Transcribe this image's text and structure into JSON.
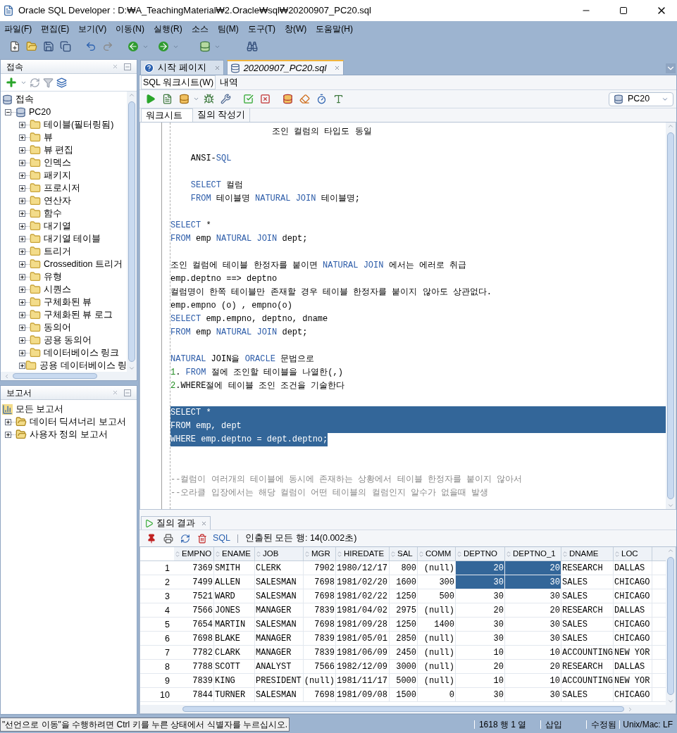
{
  "window": {
    "title": "Oracle SQL Developer : D:₩A_TeachingMaterial₩2.Oracle₩sql₩20200907_PC20.sql"
  },
  "menu": [
    "파일(F)",
    "편집(E)",
    "보기(V)",
    "이동(N)",
    "실행(R)",
    "소스",
    "팀(M)",
    "도구(T)",
    "창(W)",
    "도움말(H)"
  ],
  "connections_panel": {
    "title": "접속",
    "tree": {
      "label": "접속",
      "children": [
        {
          "label": "PC20",
          "expanded": true,
          "children": [
            {
              "label": "테이블(필터링됨)",
              "expanded": false
            },
            {
              "label": "뷰",
              "expanded": false
            },
            {
              "label": "뷰 편집",
              "expanded": false
            },
            {
              "label": "인덱스",
              "expanded": false
            },
            {
              "label": "패키지",
              "expanded": false
            },
            {
              "label": "프로시저",
              "expanded": false
            },
            {
              "label": "연산자",
              "expanded": false
            },
            {
              "label": "함수",
              "expanded": false
            },
            {
              "label": "대기열",
              "expanded": false
            },
            {
              "label": "대기열 테이블",
              "expanded": false
            },
            {
              "label": "트리거",
              "expanded": false
            },
            {
              "label": "Crossedition 트리거",
              "expanded": false
            },
            {
              "label": "유형",
              "expanded": false
            },
            {
              "label": "시퀀스",
              "expanded": false
            },
            {
              "label": "구체화된 뷰",
              "expanded": false
            },
            {
              "label": "구체화된 뷰 로그",
              "expanded": false
            },
            {
              "label": "동의어",
              "expanded": false
            },
            {
              "label": "공용 동의어",
              "expanded": false
            },
            {
              "label": "데이터베이스 링크",
              "expanded": false
            },
            {
              "label": "공용 데이터베이스 링",
              "expanded": false
            }
          ]
        }
      ]
    }
  },
  "reports_panel": {
    "title": "보고서",
    "tree": {
      "label": "모든 보고서",
      "children": [
        {
          "label": "데이터 딕셔너리 보고서",
          "expanded": false
        },
        {
          "label": "사용자 정의 보고서",
          "expanded": false
        }
      ]
    }
  },
  "document_tabs": [
    {
      "label": "시작 페이지",
      "kind": "help",
      "selected": false
    },
    {
      "label": "20200907_PC20.sql",
      "kind": "sql",
      "selected": true
    }
  ],
  "editor_tabs": [
    {
      "label": "SQL 워크시트(W)",
      "selected": true
    },
    {
      "label": "내역",
      "selected": false
    }
  ],
  "connection": "PC20",
  "worksheet_tabs": [
    {
      "label": "워크시트",
      "selected": true
    },
    {
      "label": "질의 작성기",
      "selected": false
    }
  ],
  "editor": {
    "lines": [
      {
        "selected": false,
        "segments": [
          {
            "kind": "text",
            "text": "                    조인 컬럼의 타입도 동일"
          }
        ]
      },
      {
        "selected": false
      },
      {
        "selected": false,
        "segments": [
          {
            "kind": "text",
            "text": "    ANSI-"
          },
          {
            "kind": "keyword",
            "text": "SQL"
          }
        ]
      },
      {
        "selected": false
      },
      {
        "selected": false,
        "segments": [
          {
            "kind": "keyword",
            "text": "    SELECT"
          },
          {
            "kind": "text",
            "text": " 컬럼"
          }
        ]
      },
      {
        "selected": false,
        "segments": [
          {
            "kind": "keyword",
            "text": "    FROM"
          },
          {
            "kind": "text",
            "text": " 테이블명 "
          },
          {
            "kind": "keyword",
            "text": "NATURAL JOIN"
          },
          {
            "kind": "text",
            "text": " 테이블명;"
          }
        ]
      },
      {
        "selected": false
      },
      {
        "selected": false,
        "segments": [
          {
            "kind": "keyword",
            "text": "SELECT"
          },
          {
            "kind": "text",
            "text": " *"
          }
        ]
      },
      {
        "selected": false,
        "segments": [
          {
            "kind": "keyword",
            "text": "FROM"
          },
          {
            "kind": "text",
            "text": " emp "
          },
          {
            "kind": "keyword",
            "text": "NATURAL JOIN"
          },
          {
            "kind": "text",
            "text": " dept;"
          }
        ]
      },
      {
        "selected": false
      },
      {
        "selected": false,
        "segments": [
          {
            "kind": "text",
            "text": "조인 컬럼에 테이블 한정자를 붙이면 "
          },
          {
            "kind": "keyword",
            "text": "NATURAL JOIN"
          },
          {
            "kind": "text",
            "text": " 에서는 에러로 취급"
          }
        ]
      },
      {
        "selected": false,
        "segments": [
          {
            "kind": "text",
            "text": "emp.deptno ==> deptno"
          }
        ]
      },
      {
        "selected": false,
        "segments": [
          {
            "kind": "text",
            "text": "컬럼명이 한쪽 테이블만 존재할 경우 테이블 한정자를 붙이지 않아도 상관없다."
          }
        ]
      },
      {
        "selected": false,
        "segments": [
          {
            "kind": "text",
            "text": "emp.empno (o) , empno(o)"
          }
        ]
      },
      {
        "selected": false,
        "segments": [
          {
            "kind": "keyword",
            "text": "SELECT"
          },
          {
            "kind": "text",
            "text": " emp.empno, deptno, dname"
          }
        ]
      },
      {
        "selected": false,
        "segments": [
          {
            "kind": "keyword",
            "text": "FROM"
          },
          {
            "kind": "text",
            "text": " emp "
          },
          {
            "kind": "keyword",
            "text": "NATURAL JOIN"
          },
          {
            "kind": "text",
            "text": " dept;"
          }
        ]
      },
      {
        "selected": false
      },
      {
        "selected": false,
        "segments": [
          {
            "kind": "keyword",
            "text": "NATURAL"
          },
          {
            "kind": "text",
            "text": " JOIN을 "
          },
          {
            "kind": "keyword",
            "text": "ORACLE"
          },
          {
            "kind": "text",
            "text": " 문법으로"
          }
        ]
      },
      {
        "selected": false,
        "segments": [
          {
            "kind": "number",
            "text": "1"
          },
          {
            "kind": "text",
            "text": ". "
          },
          {
            "kind": "keyword",
            "text": "FROM"
          },
          {
            "kind": "text",
            "text": " 절에 조인할 테이블을 나열한(,)"
          }
        ]
      },
      {
        "selected": false,
        "segments": [
          {
            "kind": "number",
            "text": "2"
          },
          {
            "kind": "text",
            "text": ".WHERE절에 테이블 조인 조건을 기술한다"
          }
        ]
      },
      {
        "selected": false
      },
      {
        "selected": true,
        "segments": [
          {
            "kind": "keyword",
            "text": "SELECT"
          },
          {
            "kind": "text",
            "text": " *"
          }
        ]
      },
      {
        "selected": true,
        "segments": [
          {
            "kind": "keyword",
            "text": "FROM"
          },
          {
            "kind": "text",
            "text": " emp, dept"
          }
        ]
      },
      {
        "selected": true,
        "segments": [
          {
            "kind": "keyword",
            "text": "WHERE"
          },
          {
            "kind": "text",
            "text": " emp.deptno = dept.deptno;"
          }
        ]
      },
      {
        "selected": false
      },
      {
        "selected": false
      },
      {
        "selected": false,
        "segments": [
          {
            "kind": "comment",
            "text": "--컬럼이 여러개의 테이블에 동시에 존재하는 상황에서 테이블 한정자를 붙이지 않아서"
          }
        ]
      },
      {
        "selected": false,
        "segments": [
          {
            "kind": "comment",
            "text": "--오라클 입장에서는 해당 컬럼이 어떤 테이블의 컬럼인지 알수가 없을때 발생"
          }
        ]
      }
    ]
  },
  "results": {
    "tab": "질의 결과",
    "sql_button": "SQL",
    "fetch_status": "인출된 모든 행: 14(0.002초)",
    "columns": [
      {
        "label": "EMPNO",
        "kind": "number"
      },
      {
        "label": "ENAME",
        "kind": "text"
      },
      {
        "label": "JOB",
        "kind": "text"
      },
      {
        "label": "MGR",
        "kind": "number"
      },
      {
        "label": "HIREDATE",
        "kind": "text"
      },
      {
        "label": "SAL",
        "kind": "number"
      },
      {
        "label": "COMM",
        "kind": "number"
      },
      {
        "label": "DEPTNO",
        "kind": "number"
      },
      {
        "label": "DEPTNO_1",
        "kind": "number"
      },
      {
        "label": "DNAME",
        "kind": "text"
      },
      {
        "label": "LOC",
        "kind": "text"
      }
    ],
    "rows": [
      {
        "number": "1",
        "cells": [
          "7369",
          "SMITH",
          "CLERK",
          "7902",
          "1980/12/17",
          "800",
          "(null)",
          "20",
          "20",
          "RESEARCH",
          "DALLAS"
        ],
        "selected": [
          false,
          false,
          false,
          false,
          false,
          false,
          false,
          true,
          true,
          false,
          false
        ]
      },
      {
        "number": "2",
        "cells": [
          "7499",
          "ALLEN",
          "SALESMAN",
          "7698",
          "1981/02/20",
          "1600",
          "300",
          "30",
          "30",
          "SALES",
          "CHICAGO"
        ],
        "selected": [
          false,
          false,
          false,
          false,
          false,
          false,
          false,
          true,
          true,
          false,
          false
        ]
      },
      {
        "number": "3",
        "cells": [
          "7521",
          "WARD",
          "SALESMAN",
          "7698",
          "1981/02/22",
          "1250",
          "500",
          "30",
          "30",
          "SALES",
          "CHICAGO"
        ],
        "selected": [
          false,
          false,
          false,
          false,
          false,
          false,
          false,
          false,
          false,
          false,
          false
        ]
      },
      {
        "number": "4",
        "cells": [
          "7566",
          "JONES",
          "MANAGER",
          "7839",
          "1981/04/02",
          "2975",
          "(null)",
          "20",
          "20",
          "RESEARCH",
          "DALLAS"
        ],
        "selected": [
          false,
          false,
          false,
          false,
          false,
          false,
          false,
          false,
          false,
          false,
          false
        ]
      },
      {
        "number": "5",
        "cells": [
          "7654",
          "MARTIN",
          "SALESMAN",
          "7698",
          "1981/09/28",
          "1250",
          "1400",
          "30",
          "30",
          "SALES",
          "CHICAGO"
        ],
        "selected": [
          false,
          false,
          false,
          false,
          false,
          false,
          false,
          false,
          false,
          false,
          false
        ]
      },
      {
        "number": "6",
        "cells": [
          "7698",
          "BLAKE",
          "MANAGER",
          "7839",
          "1981/05/01",
          "2850",
          "(null)",
          "30",
          "30",
          "SALES",
          "CHICAGO"
        ],
        "selected": [
          false,
          false,
          false,
          false,
          false,
          false,
          false,
          false,
          false,
          false,
          false
        ]
      },
      {
        "number": "7",
        "cells": [
          "7782",
          "CLARK",
          "MANAGER",
          "7839",
          "1981/06/09",
          "2450",
          "(null)",
          "10",
          "10",
          "ACCOUNTING",
          "NEW YOR"
        ],
        "selected": [
          false,
          false,
          false,
          false,
          false,
          false,
          false,
          false,
          false,
          false,
          false
        ]
      },
      {
        "number": "8",
        "cells": [
          "7788",
          "SCOTT",
          "ANALYST",
          "7566",
          "1982/12/09",
          "3000",
          "(null)",
          "20",
          "20",
          "RESEARCH",
          "DALLAS"
        ],
        "selected": [
          false,
          false,
          false,
          false,
          false,
          false,
          false,
          false,
          false,
          false,
          false
        ]
      },
      {
        "number": "9",
        "cells": [
          "7839",
          "KING",
          "PRESIDENT",
          "(null)",
          "1981/11/17",
          "5000",
          "(null)",
          "10",
          "10",
          "ACCOUNTING",
          "NEW YOR"
        ],
        "selected": [
          false,
          false,
          false,
          false,
          false,
          false,
          false,
          false,
          false,
          false,
          false
        ]
      },
      {
        "number": "10",
        "cells": [
          "7844",
          "TURNER",
          "SALESMAN",
          "7698",
          "1981/09/08",
          "1500",
          "0",
          "30",
          "30",
          "SALES",
          "CHICAGO"
        ],
        "selected": [
          false,
          false,
          false,
          false,
          false,
          false,
          false,
          false,
          false,
          false,
          false
        ]
      }
    ]
  },
  "status_bar": {
    "hint": "\"선언으로 이동\"을 수행하려면 Ctrl 키를 누른 상태에서 식별자를 누르십시오.",
    "position": "1618 행 1 열",
    "mode": "삽입",
    "state": "수정됨",
    "line_ending": "Unix/Mac: LF"
  }
}
